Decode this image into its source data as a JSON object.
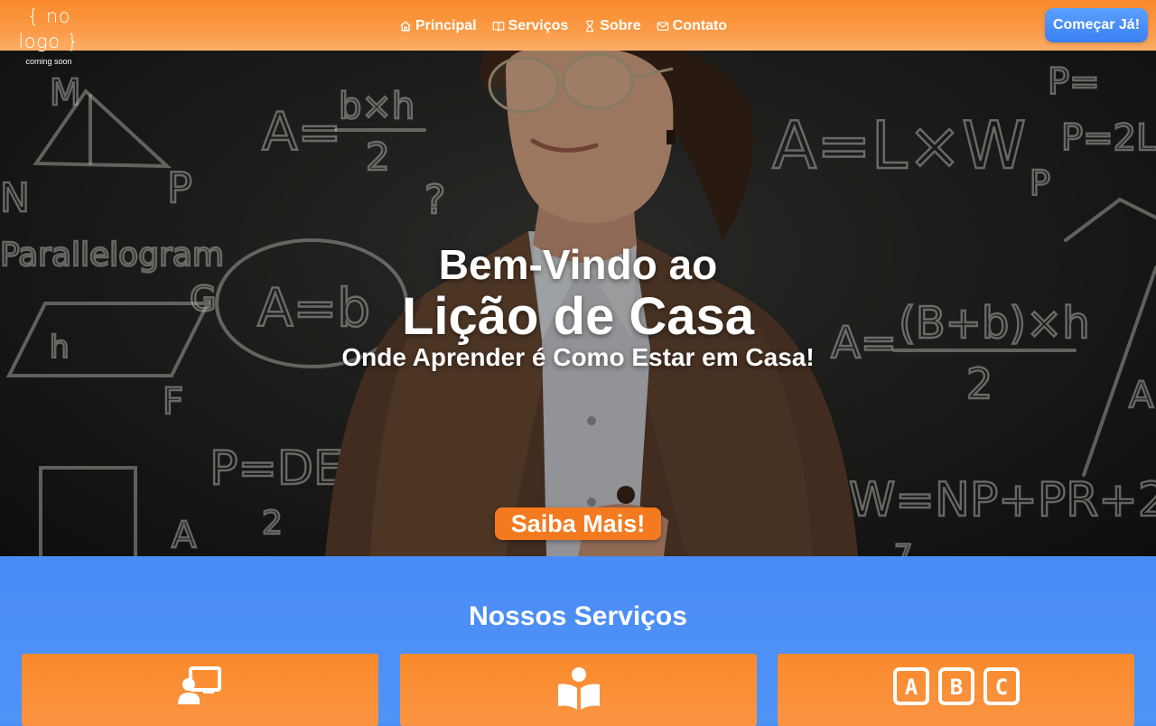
{
  "header": {
    "logo_text": "{ no logo }",
    "logo_subtext": "coming soon",
    "nav": [
      {
        "label": "Principal",
        "icon": "home-icon"
      },
      {
        "label": "Serviços",
        "icon": "book-open-icon"
      },
      {
        "label": "Sobre",
        "icon": "hourglass-icon"
      },
      {
        "label": "Contato",
        "icon": "mail-icon"
      }
    ],
    "cta_label": "Começar Já!"
  },
  "hero": {
    "line1": "Bem-Vindo ao",
    "line2": "Lição de Casa",
    "line3": "Onde Aprender é Como Estar em Casa!",
    "button_label": "Saiba Mais!"
  },
  "services": {
    "title": "Nossos Serviços",
    "cards": [
      {
        "icon": "teacher-board-icon"
      },
      {
        "icon": "reader-book-icon"
      },
      {
        "icon": "abc-blocks-icon"
      }
    ]
  },
  "colors": {
    "header_orange": "#f98a2c",
    "accent_blue": "#3b7ff2",
    "services_bg": "#4a8cf6",
    "card_orange": "#f98a2b",
    "button_orange": "#f47a1f"
  }
}
